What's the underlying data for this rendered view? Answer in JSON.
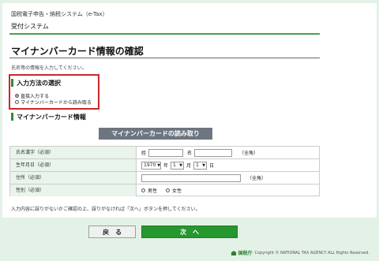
{
  "header": {
    "system_name": "国税電子申告・納税システム（e-Tax）",
    "subsystem": "受付システム"
  },
  "page_title": "マイナンバーカード情報の確認",
  "instruction": "氏名等の情報を入力してください。",
  "input_method": {
    "heading": "入力方法の選択",
    "options": [
      {
        "label": "直接入力する",
        "selected": true
      },
      {
        "label": "マイナンバーカードから読み取る",
        "selected": false
      }
    ]
  },
  "card_section": {
    "heading": "マイナンバーカード情報",
    "read_button": "マイナンバーカードの読み取り"
  },
  "form": {
    "name": {
      "label": "氏名漢字（必須）",
      "surname_label": "姓",
      "given_label": "名",
      "note": "（全角）"
    },
    "birthdate": {
      "label": "生年月日（必須）",
      "year_value": "1970",
      "year_unit": "年",
      "month_value": "1",
      "month_unit": "月",
      "day_value": "1",
      "day_unit": "日"
    },
    "address": {
      "label": "住所（必須）",
      "note": "（全角）"
    },
    "gender": {
      "label": "性別（必須）",
      "options": [
        "男性",
        "女性"
      ]
    }
  },
  "confirm_note": "入力内容に誤りがないかご確認の上、誤りがなければ「次へ」ボタンを押してください。",
  "buttons": {
    "back": "戻　る",
    "next": "次　へ"
  },
  "footer": {
    "logo_text": "国税庁",
    "copyright": "Copyright © NATIONAL TAX AGENCY ALL Rights Reserved."
  },
  "colors": {
    "accent_green": "#49a14a",
    "button_green": "#26962e",
    "highlight_red": "#c8282e",
    "read_button_gray": "#6d7680",
    "page_bg": "#e4f1e6"
  }
}
